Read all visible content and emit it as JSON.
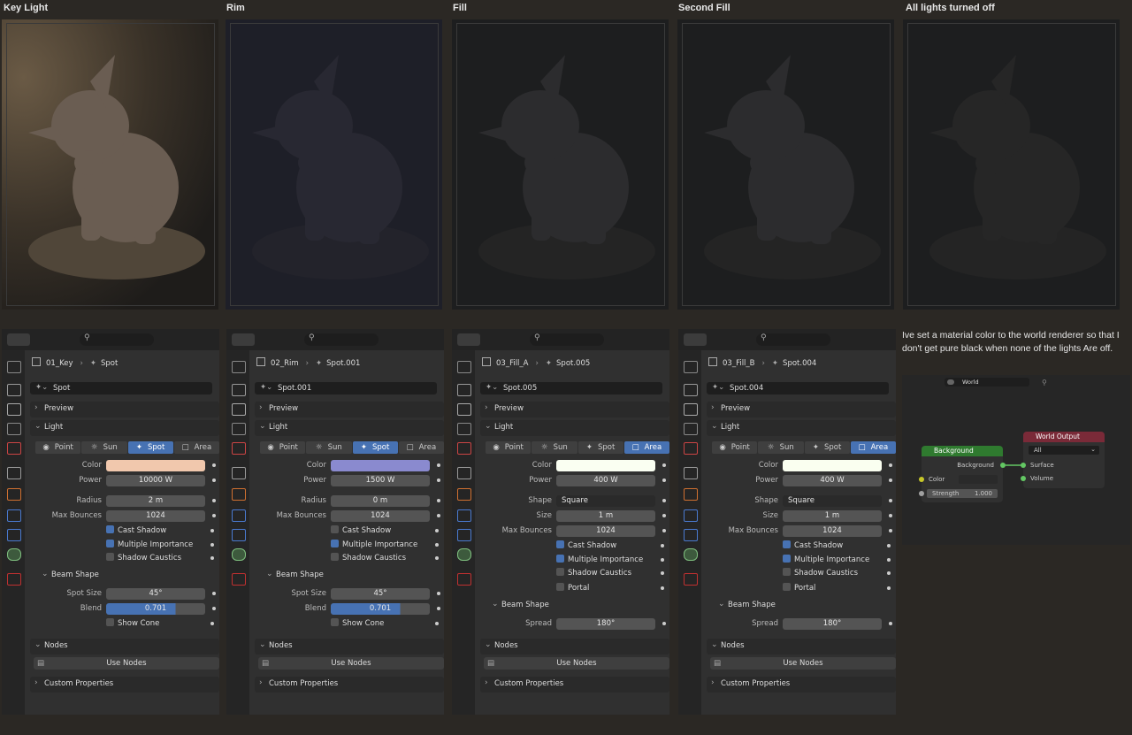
{
  "captions": [
    "Key Light",
    "Rim",
    "Fill",
    "Second Fill",
    "All lights turned off"
  ],
  "render_tints": [
    "#5a5040",
    "#22223a",
    "#22282a",
    "#242826",
    "#1f1f1f"
  ],
  "note": "Ive set a material color to the world renderer so that I don't get pure black when none of the lights Are off.",
  "light_types": [
    "Point",
    "Sun",
    "Spot",
    "Area"
  ],
  "labels": {
    "preview": "Preview",
    "light": "Light",
    "color": "Color",
    "power": "Power",
    "radius": "Radius",
    "max_bounces": "Max Bounces",
    "cast_shadow": "Cast Shadow",
    "multiple_importance": "Multiple Importance",
    "shadow_caustics": "Shadow Caustics",
    "portal": "Portal",
    "beam_shape": "Beam Shape",
    "spot_size": "Spot Size",
    "blend": "Blend",
    "show_cone": "Show Cone",
    "shape": "Shape",
    "size": "Size",
    "spread": "Spread",
    "nodes": "Nodes",
    "use_nodes": "Use Nodes",
    "custom_properties": "Custom Properties"
  },
  "panels": [
    {
      "object": "01_Key",
      "light": "Spot",
      "datablock": "Spot",
      "type": "Spot",
      "color": "#f1c8ad",
      "power": "10000 W",
      "radius": "2 m",
      "max_bounces": "1024",
      "cast_shadow": true,
      "multiple_importance": true,
      "spot_size": "45°",
      "blend": "0.701",
      "blend_fill": 0.701
    },
    {
      "object": "02_Rim",
      "light": "Spot.001",
      "datablock": "Spot.001",
      "type": "Spot",
      "color": "#8a8acf",
      "power": "1500 W",
      "radius": "0 m",
      "max_bounces": "1024",
      "cast_shadow": false,
      "multiple_importance": true,
      "spot_size": "45°",
      "blend": "0.701",
      "blend_fill": 0.701
    },
    {
      "object": "03_Fill_A",
      "light": "Spot.005",
      "datablock": "Spot.005",
      "type": "Area",
      "color": "#fafff2",
      "power": "400 W",
      "shape": "Square",
      "size": "1 m",
      "max_bounces": "1024",
      "cast_shadow": true,
      "multiple_importance": true,
      "spread": "180°"
    },
    {
      "object": "03_Fill_B",
      "light": "Spot.004",
      "datablock": "Spot.004",
      "type": "Area",
      "color": "#fafff0",
      "power": "400 W",
      "shape": "Square",
      "size": "1 m",
      "max_bounces": "1024",
      "cast_shadow": true,
      "multiple_importance": true,
      "spread": "180°"
    }
  ],
  "node_editor": {
    "world_name": "World",
    "background_node": {
      "title": "Background",
      "output": "Background",
      "color_label": "Color",
      "strength_label": "Strength",
      "strength": "1.000"
    },
    "output_node": {
      "title": "World Output",
      "target": "All",
      "surface": "Surface",
      "volume": "Volume"
    }
  }
}
